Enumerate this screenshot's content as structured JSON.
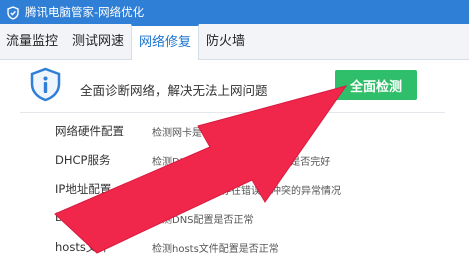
{
  "window": {
    "title": "腾讯电脑管家-网络优化"
  },
  "tabs": [
    {
      "label": "流量监控"
    },
    {
      "label": "测试网速"
    },
    {
      "label": "网络修复"
    },
    {
      "label": "防火墙"
    }
  ],
  "banner": {
    "text": "全面诊断网络，解决无法上网问题",
    "button": "全面检测"
  },
  "items": [
    {
      "name": "网络硬件配置",
      "desc": "检测网卡是否正常"
    },
    {
      "name": "DHCP服务",
      "desc": "检测DHCP服务相关注册表设置是否完好"
    },
    {
      "name": "IP地址配置",
      "desc": "检测IP地址是否存在错误或冲突的异常情况"
    },
    {
      "name": "DNS",
      "desc": "检测DNS配置是否正常"
    },
    {
      "name": "hosts文件",
      "desc": "检测hosts文件配置是否正常"
    }
  ],
  "colors": {
    "titlebar": "#2f7fd6",
    "button": "#2fbf6a",
    "arrow": "#f0264b"
  }
}
